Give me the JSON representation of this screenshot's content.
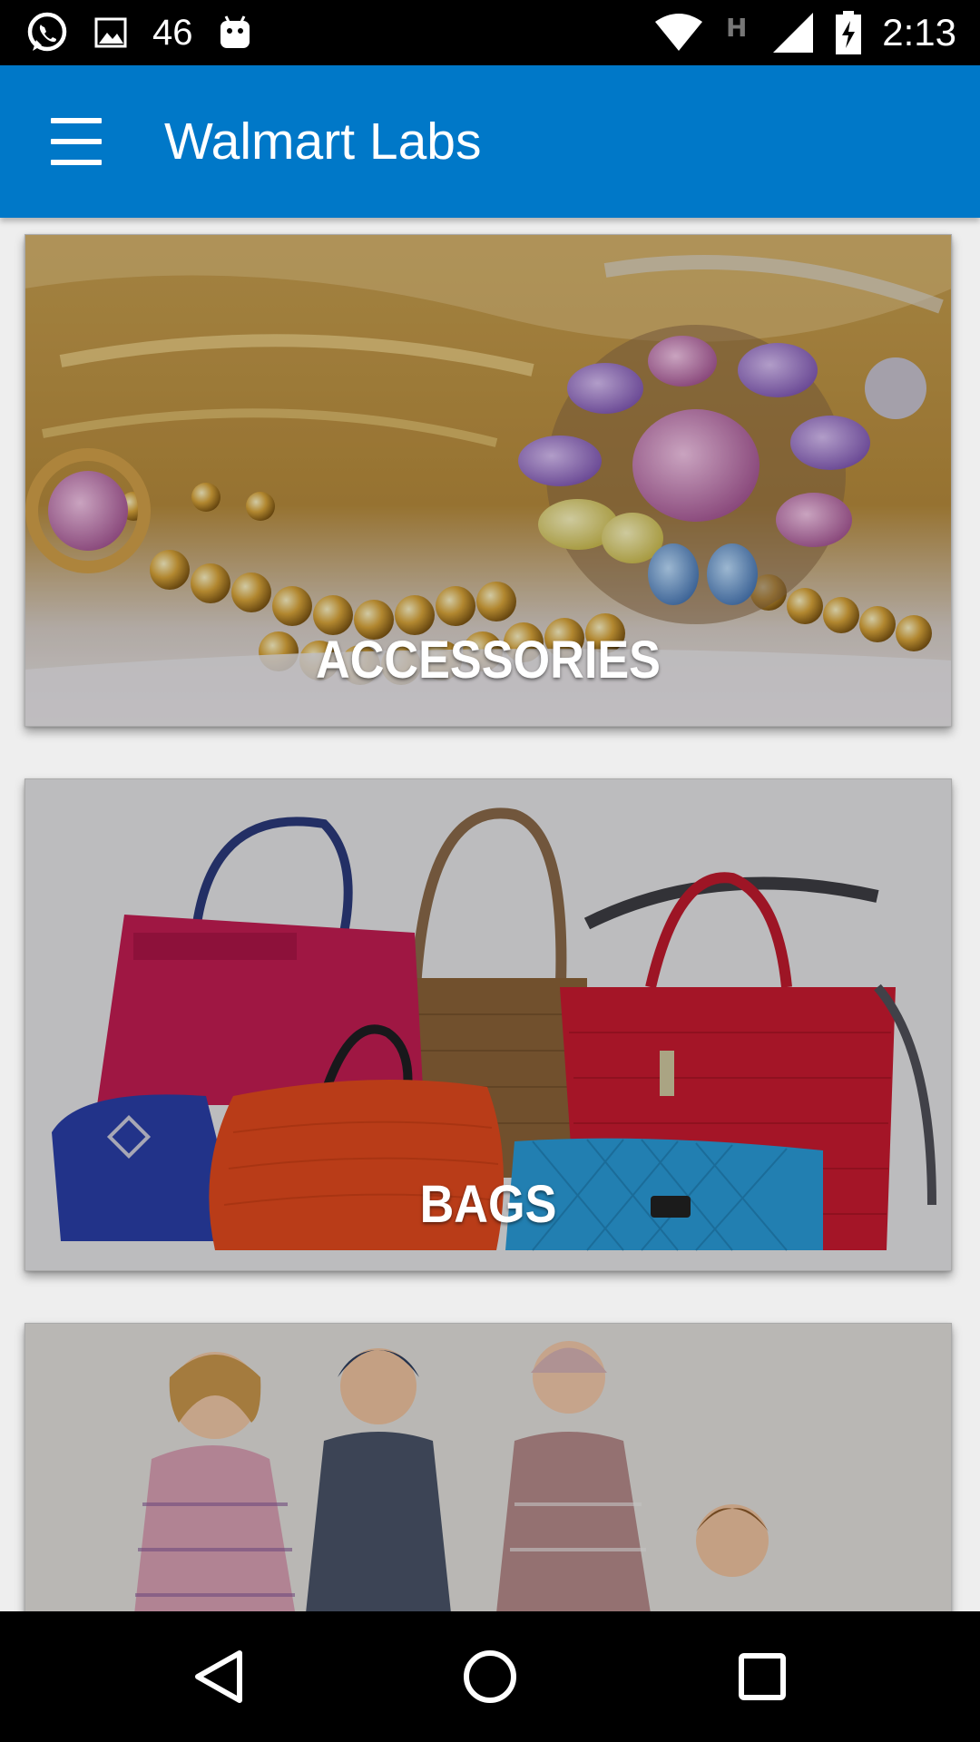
{
  "status_bar": {
    "notification_count": "46",
    "time": "2:13",
    "icons": [
      "whatsapp-icon",
      "gallery-icon",
      "android-icon",
      "wifi-icon",
      "h-network-icon",
      "signal-icon",
      "battery-charging-icon"
    ]
  },
  "app_bar": {
    "title": "Walmart Labs",
    "menu_icon": "hamburger-menu-icon",
    "color": "#0078c8"
  },
  "categories": [
    {
      "label": "ACCESSORIES"
    },
    {
      "label": "BAGS"
    },
    {
      "label": ""
    }
  ],
  "nav_bar": {
    "icons": [
      "back-icon",
      "home-icon",
      "recents-icon"
    ]
  }
}
